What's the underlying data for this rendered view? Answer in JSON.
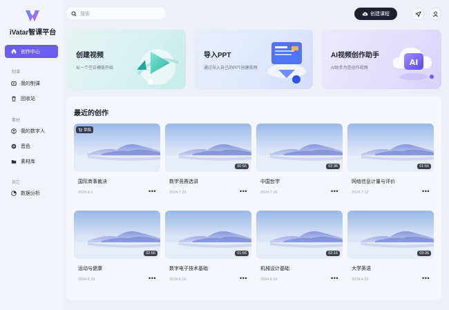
{
  "app": {
    "logo_text": "iVatar智课平台"
  },
  "sidebar": {
    "active_item": "创作中心",
    "sections": [
      {
        "label": "制课",
        "items": [
          "我的制课",
          "回收站"
        ]
      },
      {
        "label": "素材",
        "items": [
          "我的数字人",
          "音色",
          "素材库"
        ]
      },
      {
        "label": "其它",
        "items": [
          "数据分析"
        ]
      }
    ]
  },
  "header": {
    "search_placeholder": "搜索",
    "create_button": "创建课程"
  },
  "features": [
    {
      "title": "创建视频",
      "subtitle": "从一个空白模版开始"
    },
    {
      "title": "导入PPT",
      "subtitle": "通过导入自己的PPT创建视频"
    },
    {
      "title": "AI视频创作助手",
      "subtitle": "AI助手为您创作视频"
    }
  ],
  "recent": {
    "title": "最近的创作",
    "draft_label": "草稿",
    "items": [
      {
        "title": "国际商事裁决",
        "date": "2024.8.1",
        "duration": "",
        "draft": true
      },
      {
        "title": "数学竞赛选讲",
        "date": "2024.7.23",
        "duration": "00:56",
        "draft": false
      },
      {
        "title": "中国哲学",
        "date": "2024.7.16",
        "duration": "02:36",
        "draft": false
      },
      {
        "title": "网络信息计量与评价",
        "date": "2024.7.12",
        "duration": "01:56",
        "draft": false
      },
      {
        "title": "运动与健康",
        "date": "2024.6.23",
        "duration": "02:56",
        "draft": false
      },
      {
        "title": "数字电子技术基础",
        "date": "2024.6.16",
        "duration": "01:56",
        "draft": false
      },
      {
        "title": "机械设计基础",
        "date": "2024.6.10",
        "duration": "02:16",
        "draft": false
      },
      {
        "title": "大学英语",
        "date": "2024.4.23",
        "duration": "03:36",
        "draft": false
      }
    ]
  },
  "colors": {
    "accent": "#6d5cf0",
    "dark_button": "#1e2030"
  }
}
